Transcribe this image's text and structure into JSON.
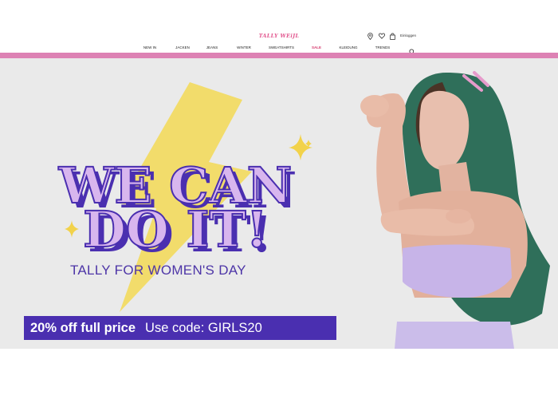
{
  "header": {
    "logo": "TALLY WEiJL",
    "login_label": "Einloggen",
    "nav": [
      {
        "label": "NEW IN",
        "sale": false
      },
      {
        "label": "JACKEN",
        "sale": false
      },
      {
        "label": "JEANS",
        "sale": false
      },
      {
        "label": "WINTER",
        "sale": false
      },
      {
        "label": "SWEATSHIRTS",
        "sale": false
      },
      {
        "label": "SALE",
        "sale": true
      },
      {
        "label": "KLEIDUNG",
        "sale": false
      },
      {
        "label": "TRENDS",
        "sale": false
      }
    ],
    "icons": [
      "location-icon",
      "heart-icon",
      "bag-icon",
      "search-icon"
    ]
  },
  "hero": {
    "headline_line1": "WE CAN",
    "headline_line2": "DO IT!",
    "subheadline": "TALLY FOR WOMEN'S DAY",
    "promo_main": "20% off full price",
    "promo_code": "Use code: GIRLS20"
  },
  "colors": {
    "brand_pink": "#dd82b4",
    "logo_pink": "#e2578f",
    "purple": "#4a2fb0",
    "lilac": "#d8b6ee",
    "bolt_yellow": "#f2dc6b",
    "hero_bg": "#eaeaea"
  }
}
